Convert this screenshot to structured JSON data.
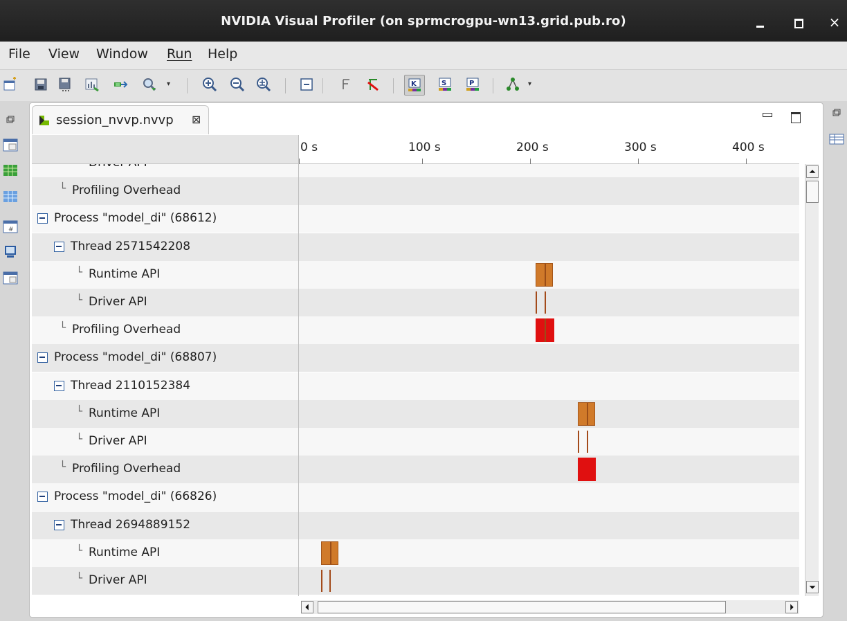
{
  "window": {
    "title": "NVIDIA Visual Profiler  (on sprmcrogpu-wn13.grid.pub.ro)",
    "min_label": "",
    "max_label": "",
    "close_label": "×"
  },
  "menu": [
    "File",
    "View",
    "Window",
    "Run",
    "Help"
  ],
  "toolbar": {
    "icons": [
      "new-session-icon",
      "save-icon",
      "save-all-icon",
      "analysis-icon",
      "export-icon",
      "search-icon",
      "zoom-in-icon",
      "zoom-out-icon",
      "zoom-to-fit-icon",
      "collapse-icon",
      "filter-icon",
      "clear-filter-icon",
      "kernel-view-icon",
      "stream-view-icon",
      "process-view-icon",
      "dependency-icon"
    ],
    "dropdown_arrow": "▾"
  },
  "editor": {
    "tab_label": "session_nvvp.nvvp",
    "tab_close": "⊠"
  },
  "timeline": {
    "ticks": [
      "0 s",
      "100 s",
      "200 s",
      "300 s",
      "400 s"
    ],
    "rows": [
      {
        "label": "Driver API",
        "kind": "leaf"
      },
      {
        "label": "Profiling Overhead",
        "kind": "leaf"
      },
      {
        "label": "Process \"model_di\" (68612)",
        "kind": "process"
      },
      {
        "label": "Thread 2571542208",
        "kind": "thread"
      },
      {
        "label": "Runtime API",
        "kind": "leaf"
      },
      {
        "label": "Driver API",
        "kind": "leaf"
      },
      {
        "label": "Profiling Overhead",
        "kind": "leaf"
      },
      {
        "label": "Process \"model_di\" (68807)",
        "kind": "process"
      },
      {
        "label": "Thread 2110152384",
        "kind": "thread"
      },
      {
        "label": "Runtime API",
        "kind": "leaf"
      },
      {
        "label": "Driver API",
        "kind": "leaf"
      },
      {
        "label": "Profiling Overhead",
        "kind": "leaf"
      },
      {
        "label": "Process \"model_di\" (66826)",
        "kind": "process"
      },
      {
        "label": "Thread 2694889152",
        "kind": "thread"
      },
      {
        "label": "Runtime API",
        "kind": "leaf"
      },
      {
        "label": "Driver API",
        "kind": "leaf"
      }
    ]
  },
  "colors": {
    "runtime_api": "#d07a2a",
    "profiling_overhead": "#e01010",
    "driver_api": "#a34a1a"
  }
}
